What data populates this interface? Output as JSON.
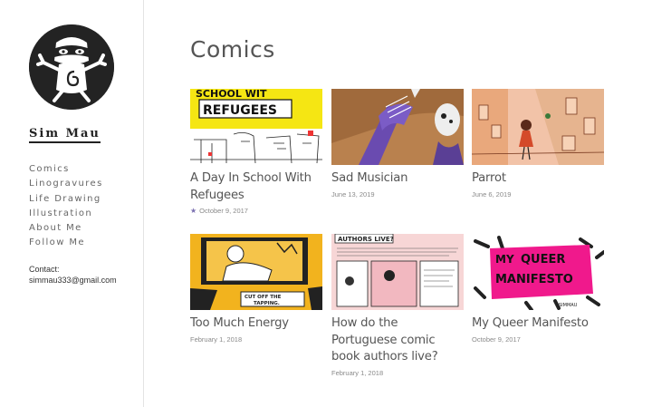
{
  "site": {
    "title": "Sim Mau",
    "logo_icon": "cartoon-face-logo"
  },
  "nav": [
    {
      "label": "Comics"
    },
    {
      "label": "Linogravures"
    },
    {
      "label": "Life Drawing"
    },
    {
      "label": "Illustration"
    },
    {
      "label": "About Me"
    },
    {
      "label": "Follow Me"
    }
  ],
  "contact": {
    "label": "Contact:",
    "email": "simmau333@gmail.com"
  },
  "page": {
    "title": "Comics"
  },
  "posts": [
    {
      "title": "A Day In School With Refugees",
      "date": "October 9, 2017",
      "sticky": true,
      "icon": "star-icon",
      "thumb_text": [
        "SCHOOL WIT",
        "REFUGEES"
      ]
    },
    {
      "title": "Sad Musician",
      "date": "June 13, 2019"
    },
    {
      "title": "Parrot",
      "date": "June 6, 2019"
    },
    {
      "title": "Too Much Energy",
      "date": "February 1, 2018",
      "thumb_text": [
        "CUT OFF THE",
        "TAPPING."
      ]
    },
    {
      "title": "How do the Portuguese comic book authors live?",
      "date": "February 1, 2018",
      "thumb_text": [
        "AUTHORS LIVE?"
      ]
    },
    {
      "title": "My Queer Manifesto",
      "date": "October 9, 2017",
      "thumb_text": [
        "MY",
        "QUEER",
        "MANIFESTO",
        "SIMMAU"
      ]
    }
  ],
  "colors": {
    "accent_star": "#7a6fb0",
    "queer_pink": "#f0198c",
    "refugee_yellow": "#f5e613"
  }
}
